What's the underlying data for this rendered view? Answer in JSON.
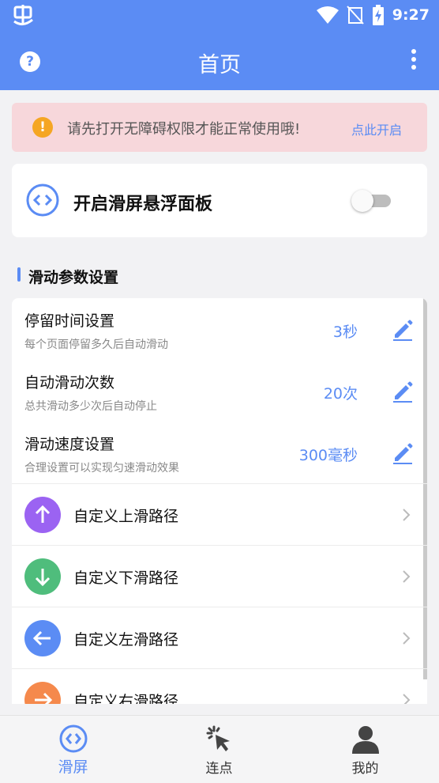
{
  "status_bar": {
    "time": "9:27"
  },
  "header": {
    "title": "首页",
    "help_icon": "question-circle-icon",
    "menu_icon": "more-vertical-icon"
  },
  "alert": {
    "text": "请先打开无障碍权限才能正常使用哦!",
    "action": "点此开启",
    "icon": "exclamation-circle-icon"
  },
  "float_panel": {
    "title": "开启滑屏悬浮面板",
    "enabled": false
  },
  "section": {
    "title": "滑动参数设置"
  },
  "params": [
    {
      "title": "停留时间设置",
      "desc": "每个页面停留多久后自动滑动",
      "value": "3秒"
    },
    {
      "title": "自动滑动次数",
      "desc": "总共滑动多少次后自动停止",
      "value": "20次"
    },
    {
      "title": "滑动速度设置",
      "desc": "合理设置可以实现匀速滑动效果",
      "value": "300毫秒"
    }
  ],
  "paths": [
    {
      "label": "自定义上滑路径",
      "color": "#9b63f2",
      "icon": "arrow-up-icon"
    },
    {
      "label": "自定义下滑路径",
      "color": "#4fbd7c",
      "icon": "arrow-down-icon"
    },
    {
      "label": "自定义左滑路径",
      "color": "#5b8cf4",
      "icon": "arrow-left-icon"
    },
    {
      "label": "自定义右滑路径",
      "color": "#f5894c",
      "icon": "arrow-right-icon"
    }
  ],
  "nav": [
    {
      "label": "滑屏",
      "active": true
    },
    {
      "label": "连点",
      "active": false
    },
    {
      "label": "我的",
      "active": false
    }
  ],
  "colors": {
    "primary": "#5b8cf4",
    "alert_bg": "#f7d7db",
    "warning": "#f5a623"
  }
}
